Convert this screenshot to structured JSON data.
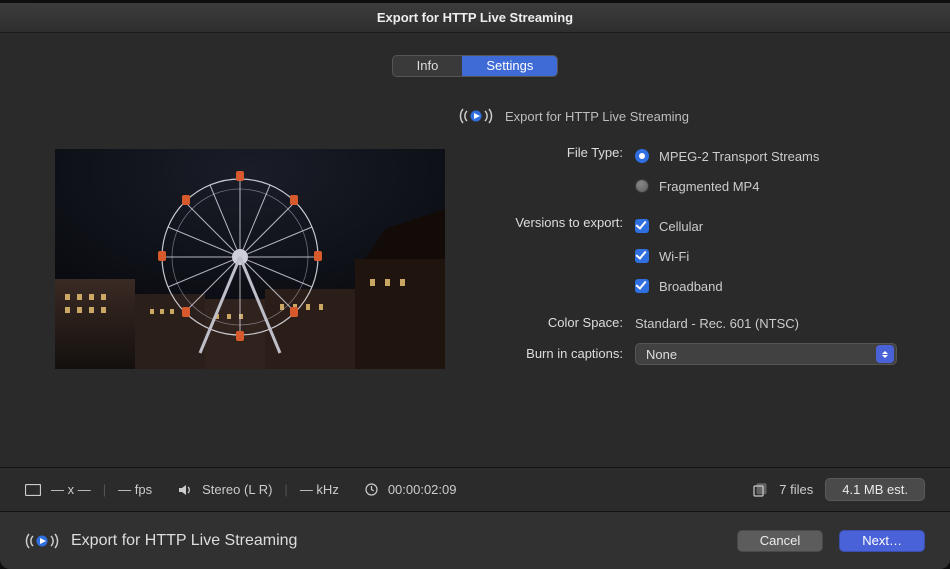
{
  "window": {
    "title": "Export for HTTP Live Streaming"
  },
  "tabs": {
    "info": "Info",
    "settings": "Settings",
    "active": "settings"
  },
  "header": {
    "preset_name": "Export for HTTP Live Streaming"
  },
  "form": {
    "file_type": {
      "label": "File Type:",
      "selected": "mpeg2",
      "options": {
        "mpeg2": "MPEG-2 Transport Streams",
        "fmp4": "Fragmented MP4"
      }
    },
    "versions": {
      "label": "Versions to export:",
      "items": [
        {
          "key": "cellular",
          "label": "Cellular",
          "checked": true
        },
        {
          "key": "wifi",
          "label": "Wi-Fi",
          "checked": true
        },
        {
          "key": "broadband",
          "label": "Broadband",
          "checked": true
        }
      ]
    },
    "color_space": {
      "label": "Color Space:",
      "value": "Standard - Rec. 601 (NTSC)"
    },
    "captions": {
      "label": "Burn in captions:",
      "selected": "None"
    }
  },
  "status": {
    "dimensions": "— x —",
    "fps": "— fps",
    "audio": "Stereo (L R)",
    "khz": "— kHz",
    "duration": "00:00:02:09",
    "file_count": "7 files",
    "size_est": "4.1 MB est."
  },
  "footer": {
    "subtitle": "Export for HTTP Live Streaming",
    "cancel": "Cancel",
    "next": "Next…"
  }
}
